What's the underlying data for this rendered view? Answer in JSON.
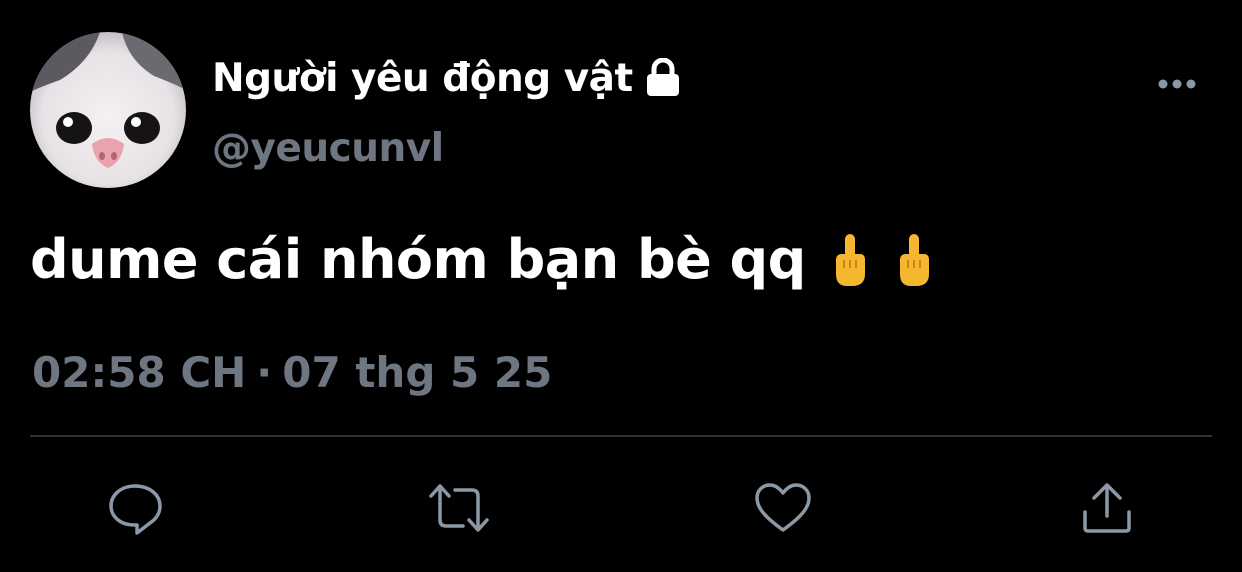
{
  "user": {
    "display_name": "Người yêu động vật",
    "handle": "@yeucunvl",
    "avatar_icon": "cat-avatar",
    "protected_icon": "lock-icon"
  },
  "tweet": {
    "text": "dume cái nhóm bạn bè qq",
    "emojis": [
      "middle-finger-emoji",
      "middle-finger-emoji"
    ]
  },
  "meta": {
    "time": "02:58 CH",
    "separator": "·",
    "date": "07 thg 5 25"
  },
  "actions": [
    {
      "name": "reply",
      "icon": "reply-icon"
    },
    {
      "name": "retweet",
      "icon": "retweet-icon"
    },
    {
      "name": "like",
      "icon": "heart-icon"
    },
    {
      "name": "share",
      "icon": "share-icon"
    }
  ],
  "colors": {
    "background": "#000000",
    "primary_text": "#ffffff",
    "secondary_text": "#6e7781",
    "icon": "#8b98a5",
    "divider": "#2f3336"
  }
}
